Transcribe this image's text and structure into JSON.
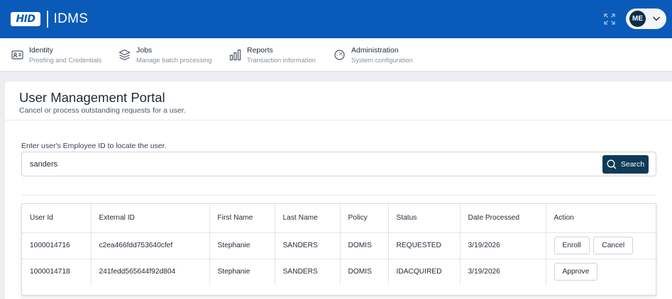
{
  "header": {
    "logo_text": "HID",
    "app_name": "IDMS",
    "user_initials": "ME"
  },
  "nav": {
    "items": [
      {
        "title": "Identity",
        "subtitle": "Proofing and Credentials",
        "icon": "id-card-icon"
      },
      {
        "title": "Jobs",
        "subtitle": "Manage batch processing",
        "icon": "layers-icon"
      },
      {
        "title": "Reports",
        "subtitle": "Transaction information",
        "icon": "bar-chart-icon"
      },
      {
        "title": "Administration",
        "subtitle": "System configuration",
        "icon": "admin-gauge-icon"
      }
    ]
  },
  "main": {
    "title": "User Management Portal",
    "subtitle": "Cancel or process outstanding requests for a user.",
    "search": {
      "label": "Enter user's Employee ID to locate the user.",
      "value": "sanders",
      "button_label": "Search"
    }
  },
  "table": {
    "columns": [
      "User Id",
      "External ID",
      "First Name",
      "Last Name",
      "Policy",
      "Status",
      "Date Processed",
      "Action"
    ],
    "rows": [
      {
        "user_id": "1000014716",
        "external_id": "c2ea466fdd753640cfef",
        "first_name": "Stephanie",
        "last_name": "SANDERS",
        "policy": "DOMIS",
        "status": "REQUESTED",
        "date": "3/19/2026",
        "actions": [
          "Enroll",
          "Cancel"
        ]
      },
      {
        "user_id": "1000014718",
        "external_id": "241fedd565644f92d804",
        "first_name": "Stephanie",
        "last_name": "SANDERS",
        "policy": "DOMIS",
        "status": "IDACQUIRED",
        "date": "3/19/2026",
        "actions": [
          "Approve"
        ]
      }
    ]
  },
  "colors": {
    "header_blue": "#0a5ab9",
    "search_button": "#0e3a55",
    "avatar_bg": "#0b2e4a"
  }
}
